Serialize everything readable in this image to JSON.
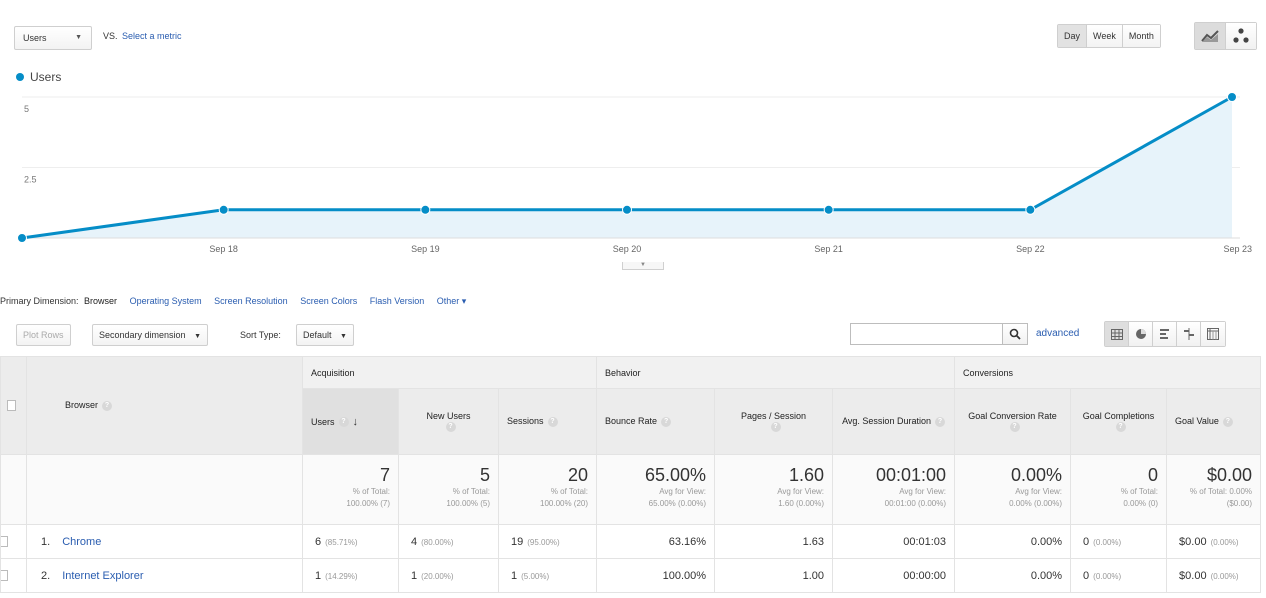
{
  "toolbar": {
    "metric": "Users",
    "vs": "VS.",
    "select_metric": "Select a metric",
    "periods": [
      "Day",
      "Week",
      "Month"
    ],
    "active_period": "Day",
    "chart_types": [
      "line-chart-icon",
      "motion-chart-icon"
    ]
  },
  "legend": {
    "series": "Users",
    "color": "#058dc7"
  },
  "chart_data": {
    "type": "area",
    "series": [
      {
        "name": "Users",
        "values": [
          0,
          1,
          1,
          1,
          1,
          1,
          5
        ]
      }
    ],
    "x": [
      "",
      "Sep 18",
      "Sep 19",
      "Sep 20",
      "Sep 21",
      "Sep 22",
      "Sep 23"
    ],
    "ylim": [
      0,
      5
    ],
    "yticks": [
      "2.5",
      "5"
    ],
    "grid": true,
    "legend": "top-left"
  },
  "dimension": {
    "label": "Primary Dimension:",
    "active": "Browser",
    "links": [
      "Operating System",
      "Screen Resolution",
      "Screen Colors",
      "Flash Version"
    ],
    "other": "Other"
  },
  "table_toolbar": {
    "plot_rows": "Plot Rows",
    "secondary": "Secondary dimension",
    "sort_label": "Sort Type:",
    "sort_value": "Default",
    "advanced": "advanced"
  },
  "table": {
    "groups": {
      "acquisition": "Acquisition",
      "behavior": "Behavior",
      "conversions": "Conversions"
    },
    "headers": {
      "browser": "Browser",
      "users": "Users",
      "new_users": "New Users",
      "sessions": "Sessions",
      "bounce_rate": "Bounce Rate",
      "pages_session": "Pages / Session",
      "avg_duration": "Avg. Session Duration",
      "goal_conv": "Goal Conversion Rate",
      "goal_comp": "Goal Completions",
      "goal_value": "Goal Value"
    },
    "totals": [
      {
        "big": "7",
        "sub1": "% of Total:",
        "sub2": "100.00% (7)"
      },
      {
        "big": "5",
        "sub1": "% of Total:",
        "sub2": "100.00% (5)"
      },
      {
        "big": "20",
        "sub1": "% of Total:",
        "sub2": "100.00% (20)"
      },
      {
        "big": "65.00%",
        "sub1": "Avg for View:",
        "sub2": "65.00% (0.00%)"
      },
      {
        "big": "1.60",
        "sub1": "Avg for View:",
        "sub2": "1.60 (0.00%)"
      },
      {
        "big": "00:01:00",
        "sub1": "Avg for View:",
        "sub2": "00:01:00 (0.00%)"
      },
      {
        "big": "0.00%",
        "sub1": "Avg for View:",
        "sub2": "0.00% (0.00%)"
      },
      {
        "big": "0",
        "sub1": "% of Total:",
        "sub2": "0.00% (0)"
      },
      {
        "big": "$0.00",
        "sub1": "% of Total: 0.00%",
        "sub2": "($0.00)"
      }
    ],
    "rows": [
      {
        "idx": "1.",
        "browser": "Chrome",
        "users": "6",
        "users_pct": "(85.71%)",
        "new_users": "4",
        "new_users_pct": "(80.00%)",
        "sessions": "19",
        "sessions_pct": "(95.00%)",
        "bounce": "63.16%",
        "pages": "1.63",
        "duration": "00:01:03",
        "conv": "0.00%",
        "comp": "0",
        "comp_pct": "(0.00%)",
        "value": "$0.00",
        "value_pct": "(0.00%)"
      },
      {
        "idx": "2.",
        "browser": "Internet Explorer",
        "users": "1",
        "users_pct": "(14.29%)",
        "new_users": "1",
        "new_users_pct": "(20.00%)",
        "sessions": "1",
        "sessions_pct": "(5.00%)",
        "bounce": "100.00%",
        "pages": "1.00",
        "duration": "00:00:00",
        "conv": "0.00%",
        "comp": "0",
        "comp_pct": "(0.00%)",
        "value": "$0.00",
        "value_pct": "(0.00%)"
      }
    ]
  }
}
